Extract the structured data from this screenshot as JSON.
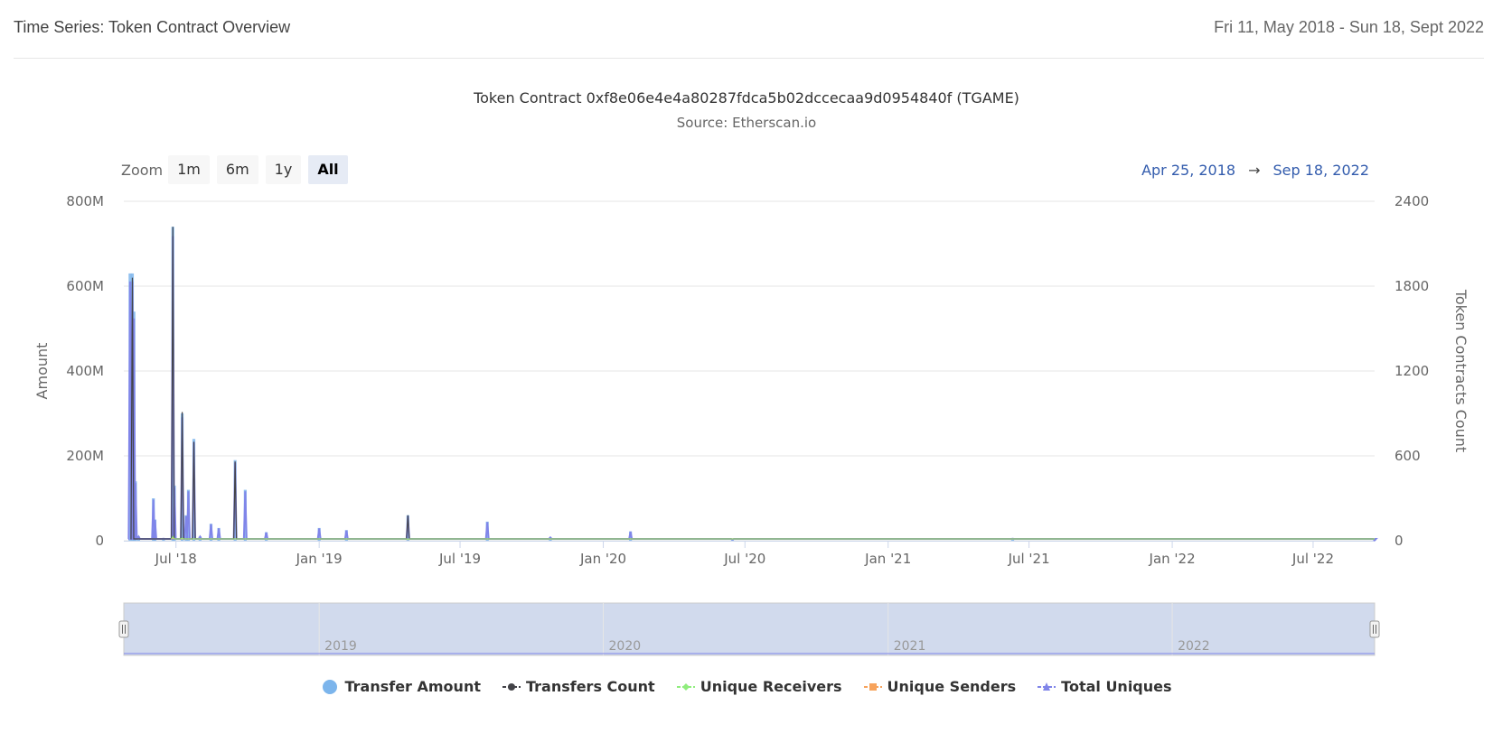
{
  "header": {
    "title": "Time Series: Token Contract Overview",
    "date_range": "Fri 11, May 2018 - Sun 18, Sept 2022"
  },
  "zoom": {
    "label": "Zoom",
    "buttons": [
      "1m",
      "6m",
      "1y",
      "All"
    ],
    "active": "All"
  },
  "range_selector": {
    "from": "Apr 25, 2018",
    "arrow": "→",
    "to": "Sep 18, 2022"
  },
  "chart_data": {
    "type": "line",
    "title": "Token Contract 0xf8e06e4e4a80287fdca5b02dccecaa9d0954840f (TGAME)",
    "subtitle": "Source: Etherscan.io",
    "y_left": {
      "label": "Amount",
      "ticks": [
        "0",
        "200M",
        "400M",
        "600M",
        "800M"
      ],
      "range": [
        0,
        800000000
      ]
    },
    "y_right": {
      "label": "Token Contracts Count",
      "ticks": [
        "0",
        "600",
        "1200",
        "1800",
        "2400"
      ],
      "range": [
        0,
        2400
      ]
    },
    "x_ticks": [
      "Jul '18",
      "Jan '19",
      "Jul '19",
      "Jan '20",
      "Jul '20",
      "Jan '21",
      "Jul '21",
      "Jan '22",
      "Jul '22"
    ],
    "x_range": [
      "2018-04-25",
      "2022-09-18"
    ],
    "navigator_labels": [
      "2019",
      "2020",
      "2021",
      "2022"
    ],
    "grid": true,
    "legend_position": "bottom",
    "colors": {
      "transfer_amount": "#7cb5ec",
      "transfers_count": "#434348",
      "unique_receivers": "#90ed7d",
      "unique_senders": "#f7a35c",
      "total_uniques": "#8085e9"
    },
    "series": [
      {
        "name": "Transfer Amount",
        "axis": "left",
        "points": [
          [
            "2018-05-03",
            630000000
          ],
          [
            "2018-05-06",
            630000000
          ],
          [
            "2018-05-08",
            540000000
          ],
          [
            "2018-05-10",
            140000000
          ],
          [
            "2018-05-14",
            10000000
          ],
          [
            "2018-06-02",
            100000000
          ],
          [
            "2018-06-04",
            50000000
          ],
          [
            "2018-06-15",
            5000000
          ],
          [
            "2018-06-27",
            740000000
          ],
          [
            "2018-06-29",
            130000000
          ],
          [
            "2018-07-09",
            300000000
          ],
          [
            "2018-07-14",
            60000000
          ],
          [
            "2018-07-17",
            120000000
          ],
          [
            "2018-07-24",
            240000000
          ],
          [
            "2018-08-01",
            10000000
          ],
          [
            "2018-08-15",
            40000000
          ],
          [
            "2018-08-25",
            30000000
          ],
          [
            "2018-09-15",
            190000000
          ],
          [
            "2018-09-28",
            120000000
          ],
          [
            "2018-10-25",
            20000000
          ],
          [
            "2019-01-01",
            30000000
          ],
          [
            "2019-02-05",
            25000000
          ],
          [
            "2019-04-25",
            60000000
          ],
          [
            "2019-08-05",
            45000000
          ],
          [
            "2019-10-25",
            8000000
          ],
          [
            "2020-02-05",
            22000000
          ],
          [
            "2020-06-15",
            3000000
          ],
          [
            "2021-06-10",
            5000000
          ],
          [
            "2022-09-18",
            1000000
          ]
        ]
      },
      {
        "name": "Transfers Count",
        "axis": "right",
        "points": [
          [
            "2018-05-06",
            1860
          ],
          [
            "2018-06-27",
            2220
          ],
          [
            "2018-07-09",
            910
          ],
          [
            "2018-07-24",
            700
          ],
          [
            "2018-09-15",
            560
          ],
          [
            "2019-04-25",
            180
          ]
        ]
      },
      {
        "name": "Unique Receivers",
        "axis": "right",
        "points": [
          [
            "2018-06-27",
            30
          ],
          [
            "2018-07-09",
            20
          ],
          [
            "2019-04-25",
            10
          ]
        ]
      },
      {
        "name": "Unique Senders",
        "axis": "right",
        "points": [
          [
            "2018-06-27",
            20
          ],
          [
            "2018-07-09",
            15
          ],
          [
            "2019-04-25",
            8
          ]
        ]
      },
      {
        "name": "Total Uniques",
        "axis": "right",
        "points": [
          [
            "2018-06-27",
            45
          ],
          [
            "2018-07-09",
            30
          ],
          [
            "2019-04-25",
            15
          ]
        ]
      }
    ]
  },
  "legend": [
    {
      "label": "Transfer Amount",
      "marker": "circle",
      "color": "#7cb5ec"
    },
    {
      "label": "Transfers Count",
      "marker": "circle-line",
      "color": "#434348"
    },
    {
      "label": "Unique Receivers",
      "marker": "diamond-line",
      "color": "#90ed7d"
    },
    {
      "label": "Unique Senders",
      "marker": "square-line",
      "color": "#f7a35c"
    },
    {
      "label": "Total Uniques",
      "marker": "triangle-line",
      "color": "#8085e9"
    }
  ]
}
